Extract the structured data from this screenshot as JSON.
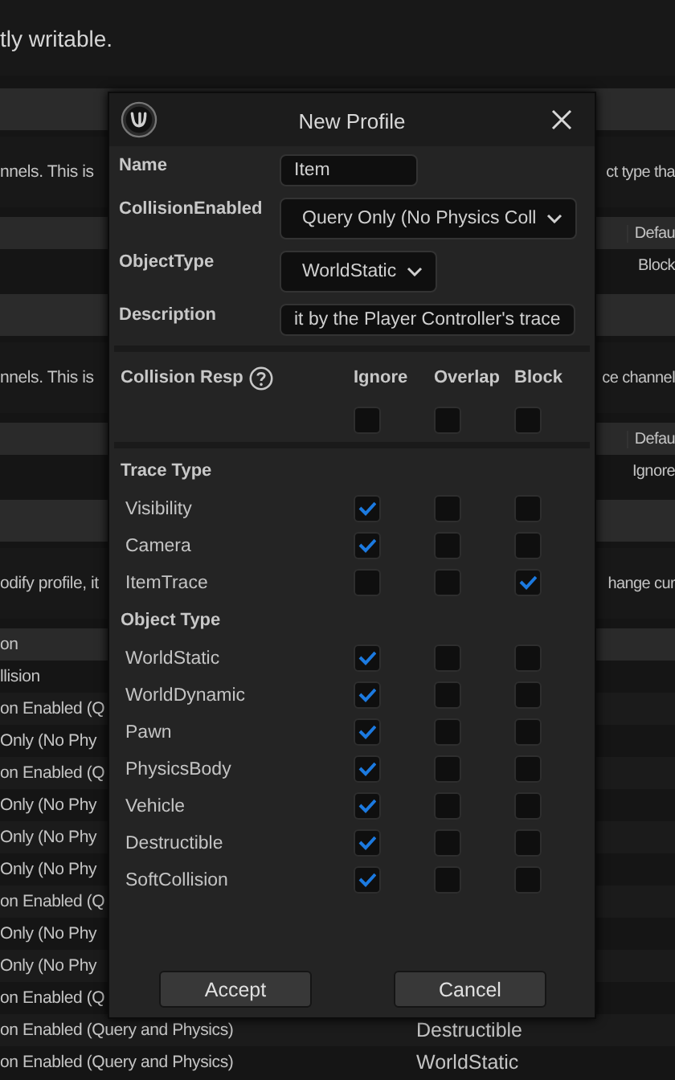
{
  "background_rows": [
    {
      "kind": "text",
      "left": "tly writable."
    },
    {
      "kind": "band"
    },
    {
      "kind": "text",
      "left": "nnels. This is",
      "right": "ct type tha"
    },
    {
      "kind": "header",
      "right": "Defau"
    },
    {
      "kind": "row",
      "right": "Block"
    },
    {
      "kind": "band"
    },
    {
      "kind": "text",
      "left": "nnels. This is",
      "right": "ce channel"
    },
    {
      "kind": "header",
      "right": "Defau"
    },
    {
      "kind": "row",
      "right": "Ignore"
    },
    {
      "kind": "band"
    },
    {
      "kind": "text",
      "left": "odify profile, it",
      "right": "hange cur"
    },
    {
      "kind": "header",
      "left": "on"
    },
    {
      "kind": "row",
      "left": "llision"
    },
    {
      "kind": "row",
      "left": "on Enabled (Q"
    },
    {
      "kind": "row",
      "left": "Only (No Phy"
    },
    {
      "kind": "row",
      "left": "on Enabled (Q"
    },
    {
      "kind": "row",
      "left": "Only (No Phy"
    },
    {
      "kind": "row",
      "left": "Only (No Phy"
    },
    {
      "kind": "row",
      "left": "Only (No Phy"
    },
    {
      "kind": "row",
      "left": "on Enabled (Q"
    },
    {
      "kind": "row",
      "left": "Only (No Phy"
    },
    {
      "kind": "row",
      "left": "Only (No Phy"
    },
    {
      "kind": "row",
      "left": "on Enabled (Q"
    },
    {
      "kind": "row",
      "left": "on Enabled (Query and Physics)",
      "middle": "Destructible"
    },
    {
      "kind": "row",
      "left": "on Enabled (Query and Physics)",
      "middle": "WorldStatic"
    }
  ],
  "dialog": {
    "title": "New Profile",
    "fields": [
      {
        "label": "Name",
        "kind": "text",
        "value": "Item"
      },
      {
        "label": "CollisionEnabled",
        "kind": "dropdown",
        "value": "Query Only (No Physics Coll"
      },
      {
        "label": "ObjectType",
        "kind": "dropdown",
        "value": "WorldStatic"
      },
      {
        "label": "Description",
        "kind": "text",
        "value": "it by the Player Controller's trace"
      }
    ],
    "responses": {
      "label": "Collision Resp",
      "columns": [
        "Ignore",
        "Overlap",
        "Block"
      ],
      "all": [
        {
          "checked": false
        },
        {
          "checked": false
        },
        {
          "checked": false
        }
      ],
      "groups": [
        {
          "title": "Trace Type",
          "channels": [
            {
              "name": "Visibility",
              "responses": [
                {
                  "checked": true
                },
                {
                  "checked": false
                },
                {
                  "checked": false
                }
              ]
            },
            {
              "name": "Camera",
              "responses": [
                {
                  "checked": true
                },
                {
                  "checked": false
                },
                {
                  "checked": false
                }
              ]
            },
            {
              "name": "ItemTrace",
              "responses": [
                {
                  "checked": false
                },
                {
                  "checked": false
                },
                {
                  "checked": true
                }
              ]
            }
          ]
        },
        {
          "title": "Object Type",
          "channels": [
            {
              "name": "WorldStatic",
              "responses": [
                {
                  "checked": true
                },
                {
                  "checked": false
                },
                {
                  "checked": false
                }
              ]
            },
            {
              "name": "WorldDynamic",
              "responses": [
                {
                  "checked": true
                },
                {
                  "checked": false
                },
                {
                  "checked": false
                }
              ]
            },
            {
              "name": "Pawn",
              "responses": [
                {
                  "checked": true
                },
                {
                  "checked": false
                },
                {
                  "checked": false
                }
              ]
            },
            {
              "name": "PhysicsBody",
              "responses": [
                {
                  "checked": true
                },
                {
                  "checked": false
                },
                {
                  "checked": false
                }
              ]
            },
            {
              "name": "Vehicle",
              "responses": [
                {
                  "checked": true
                },
                {
                  "checked": false
                },
                {
                  "checked": false
                }
              ]
            },
            {
              "name": "Destructible",
              "responses": [
                {
                  "checked": true
                },
                {
                  "checked": false
                },
                {
                  "checked": false
                }
              ]
            },
            {
              "name": "SoftCollision",
              "responses": [
                {
                  "checked": true
                },
                {
                  "checked": false
                },
                {
                  "checked": false
                }
              ]
            }
          ]
        }
      ]
    },
    "buttons": [
      "Accept",
      "Cancel"
    ]
  }
}
